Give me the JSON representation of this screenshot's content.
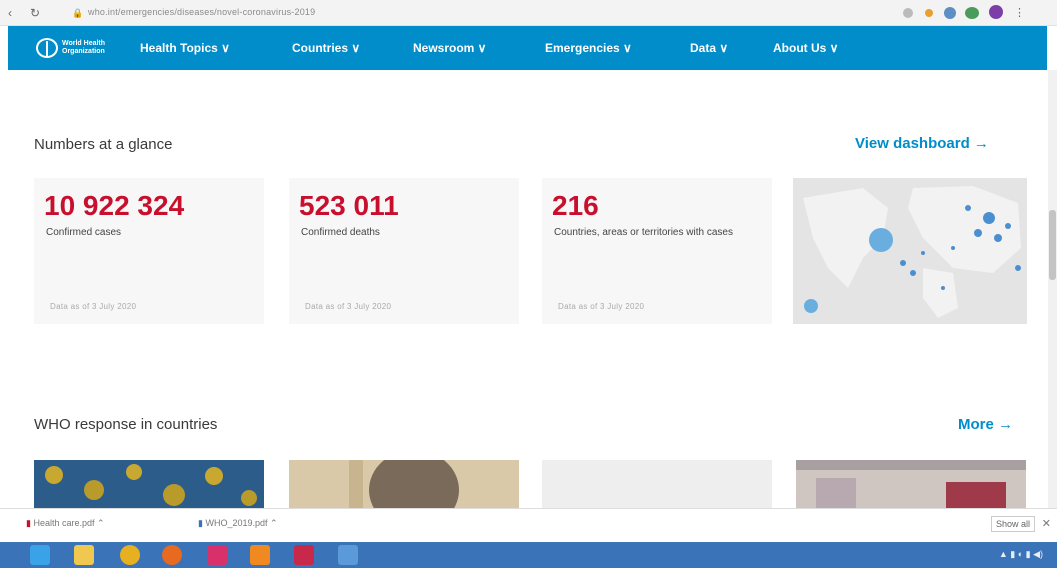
{
  "browser": {
    "back_icon": "‹",
    "reload_icon": "↻",
    "url": "who.int/emergencies/diseases/novel-coronavirus-2019"
  },
  "nav": {
    "logo_text": "World Health Organization",
    "items": [
      {
        "label": "Health Topics ∨"
      },
      {
        "label": "Countries ∨"
      },
      {
        "label": "Newsroom ∨"
      },
      {
        "label": "Emergencies ∨"
      },
      {
        "label": "Data ∨"
      },
      {
        "label": "About Us ∨"
      }
    ]
  },
  "numbers": {
    "title": "Numbers at a glance",
    "link": "View dashboard →",
    "cards": [
      {
        "value": "10 922 324",
        "label": "Confirmed cases",
        "date": "Data as of 3 July 2020"
      },
      {
        "value": "523 011",
        "label": "Confirmed deaths",
        "date": "Data as of 3 July 2020"
      },
      {
        "value": "216",
        "label": "Countries, areas or territories with cases",
        "date": "Data as of 3 July 2020"
      }
    ]
  },
  "response": {
    "title": "WHO response in countries",
    "link": "More →"
  },
  "downloads": {
    "items": [
      {
        "label": "Health care.pdf"
      },
      {
        "label": "WHO_2019.pdf"
      }
    ],
    "show_all": "Show all",
    "close": "✕"
  },
  "colors": {
    "brand": "#008dc9",
    "stat_red": "#c8102e",
    "taskbar": "#3b73b8"
  }
}
